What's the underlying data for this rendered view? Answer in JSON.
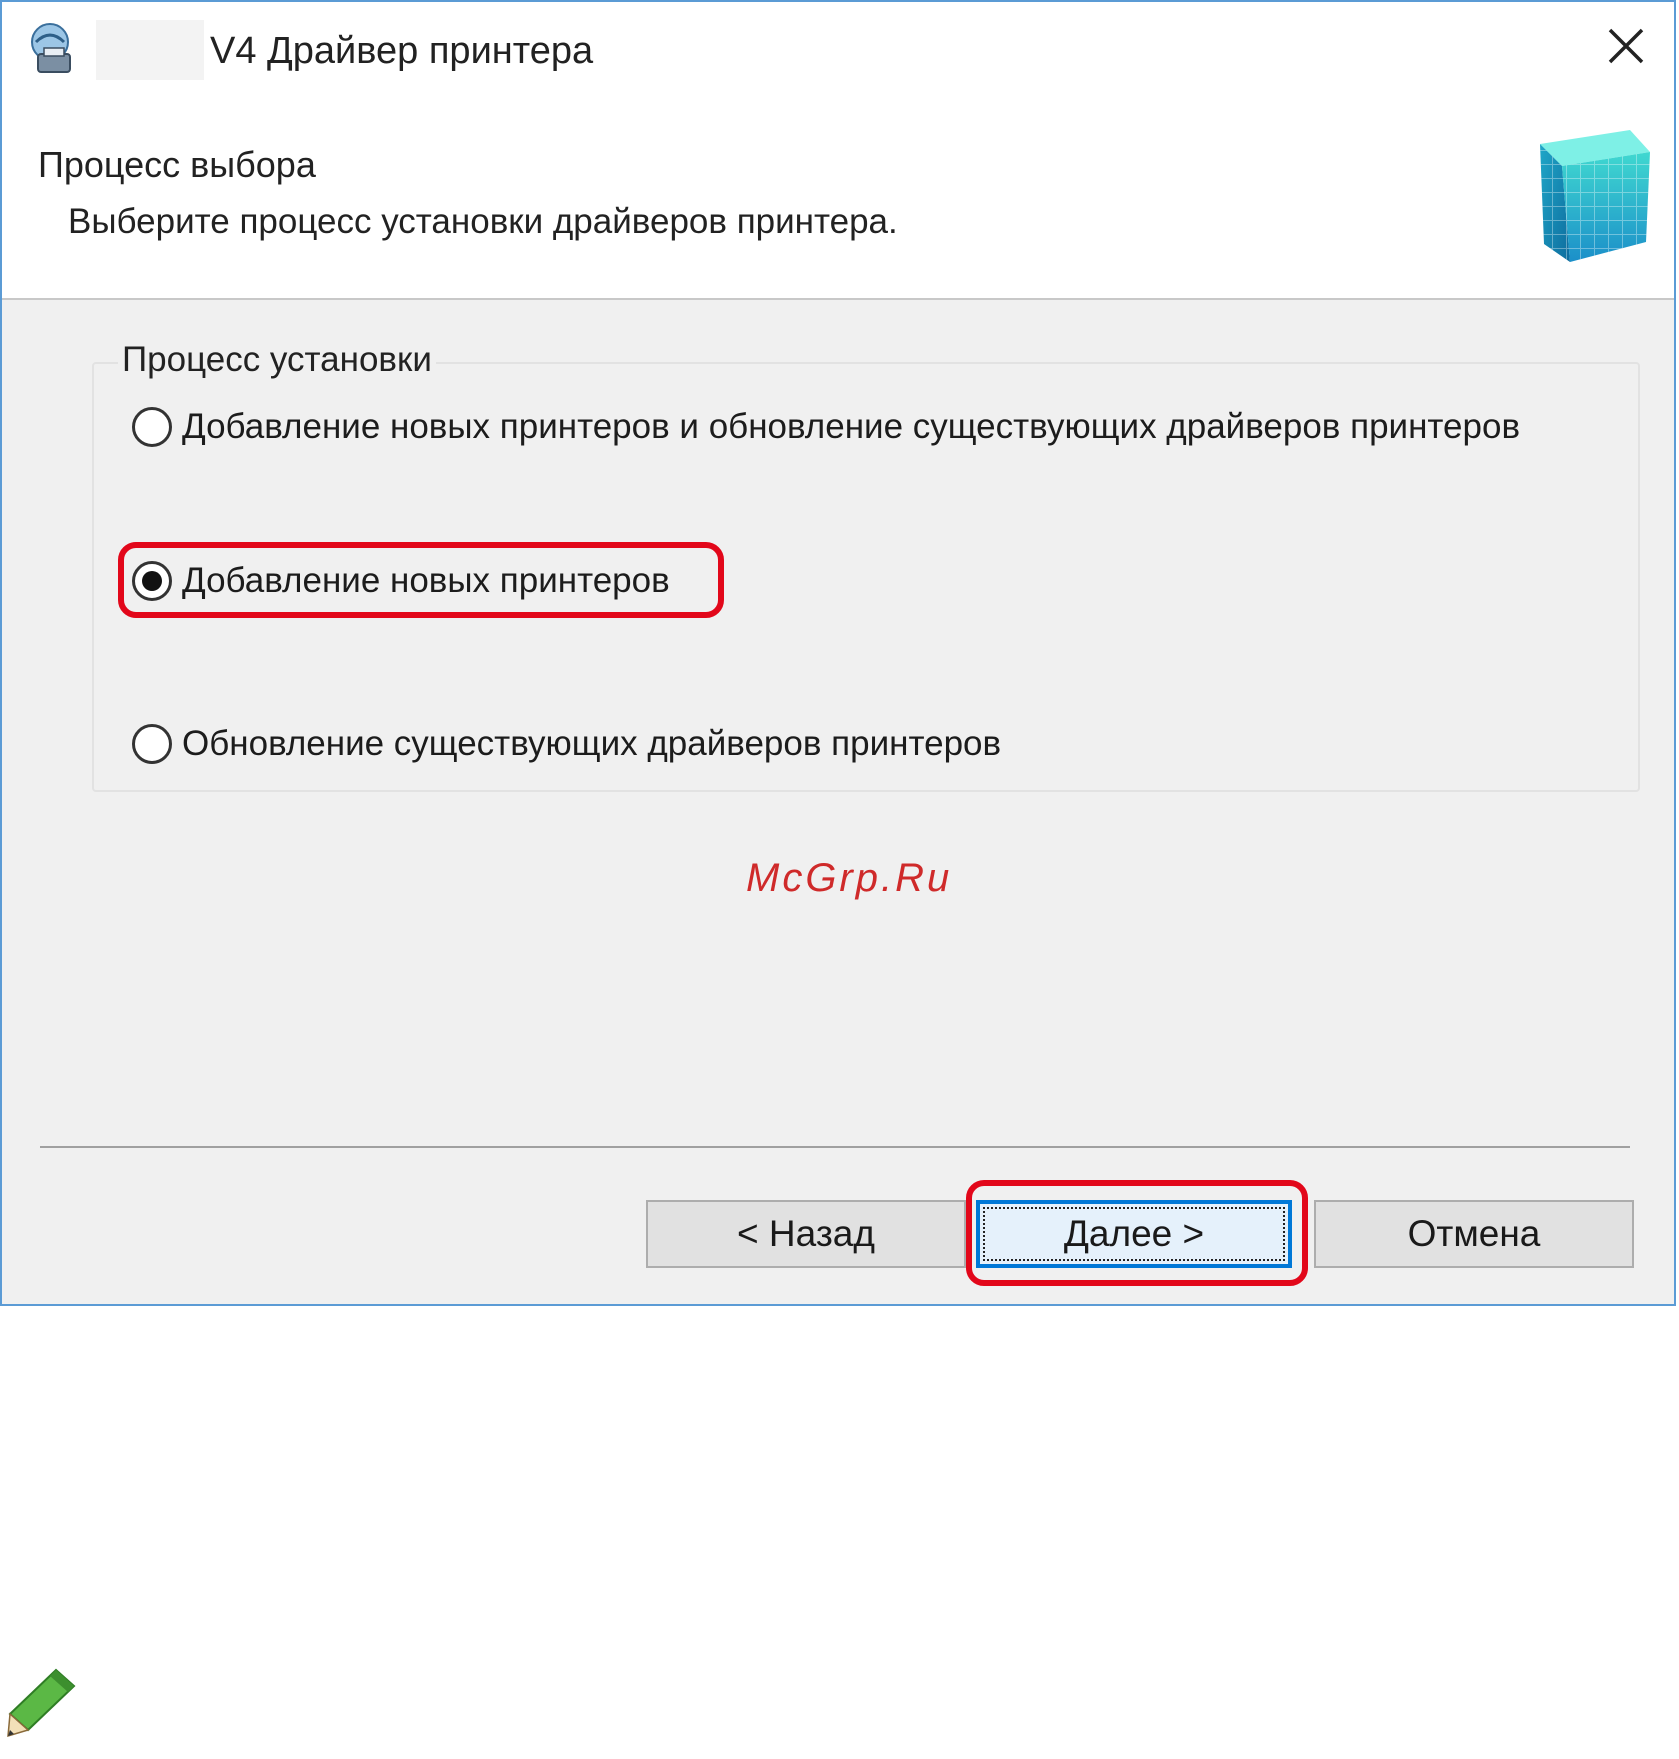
{
  "window": {
    "title": "V4 Драйвер принтера",
    "icon": "printer-setup-icon",
    "close_icon": "close-icon"
  },
  "header": {
    "title": "Процесс выбора",
    "subtitle": "Выберите процесс установки драйверов принтера.",
    "icon": "cube-icon"
  },
  "install_group": {
    "legend": "Процесс установки",
    "options": [
      {
        "label": "Добавление новых принтеров и обновление существующих драйверов принтеров",
        "selected": false
      },
      {
        "label": "Добавление новых принтеров",
        "selected": true
      },
      {
        "label": "Обновление существующих драйверов принтеров",
        "selected": false
      }
    ]
  },
  "watermark": "McGrp.Ru",
  "buttons": {
    "back": "< Назад",
    "next": "Далее >",
    "cancel": "Отмена"
  },
  "highlight_color": "#e2071a",
  "accent_color": "#0078d7",
  "footer_icon": "pencil-icon"
}
